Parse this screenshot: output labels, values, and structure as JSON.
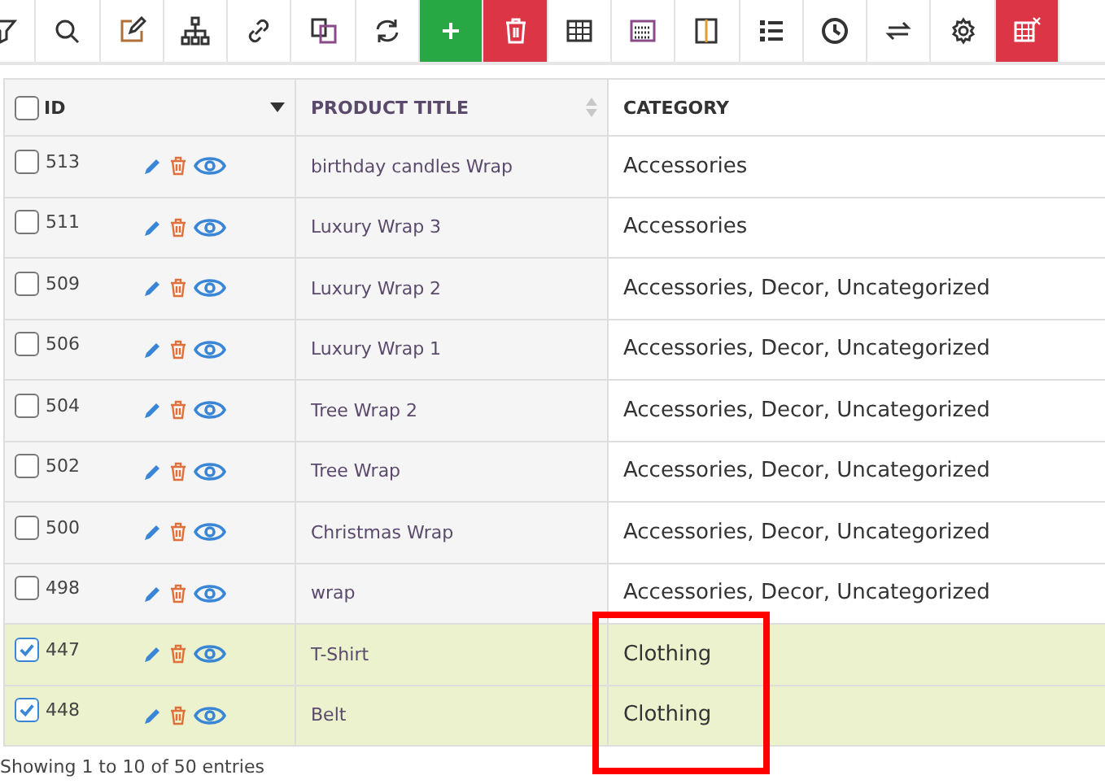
{
  "toolbar": [
    {
      "kind": "filter"
    },
    {
      "kind": "search"
    },
    {
      "kind": "edit"
    },
    {
      "kind": "hierarchy"
    },
    {
      "kind": "link"
    },
    {
      "kind": "copy"
    },
    {
      "kind": "refresh"
    },
    {
      "kind": "plus"
    },
    {
      "kind": "trash"
    },
    {
      "kind": "table"
    },
    {
      "kind": "grid"
    },
    {
      "kind": "columns"
    },
    {
      "kind": "list"
    },
    {
      "kind": "clock"
    },
    {
      "kind": "swap"
    },
    {
      "kind": "gear"
    },
    {
      "kind": "table-remove"
    }
  ],
  "table": {
    "select_all_checked": false,
    "columns": [
      "ID",
      "PRODUCT TITLE",
      "CATEGORY"
    ],
    "rows": [
      {
        "id": "513",
        "title": "birthday candles Wrap",
        "category": "Accessories",
        "checked": false
      },
      {
        "id": "511",
        "title": "Luxury Wrap 3",
        "category": "Accessories",
        "checked": false
      },
      {
        "id": "509",
        "title": "Luxury Wrap 2",
        "category": "Accessories, Decor, Uncategorized",
        "checked": false
      },
      {
        "id": "506",
        "title": "Luxury Wrap 1",
        "category": "Accessories, Decor, Uncategorized",
        "checked": false
      },
      {
        "id": "504",
        "title": "Tree Wrap 2",
        "category": "Accessories, Decor, Uncategorized",
        "checked": false
      },
      {
        "id": "502",
        "title": "Tree Wrap",
        "category": "Accessories, Decor, Uncategorized",
        "checked": false
      },
      {
        "id": "500",
        "title": "Christmas Wrap",
        "category": "Accessories, Decor, Uncategorized",
        "checked": false
      },
      {
        "id": "498",
        "title": "wrap",
        "category": "Accessories, Decor, Uncategorized",
        "checked": false
      },
      {
        "id": "447",
        "title": "T-Shirt",
        "category": "Clothing",
        "checked": true
      },
      {
        "id": "448",
        "title": "Belt",
        "category": "Clothing",
        "checked": true
      }
    ]
  },
  "footer": "Showing 1 to 10 of 50 entries"
}
